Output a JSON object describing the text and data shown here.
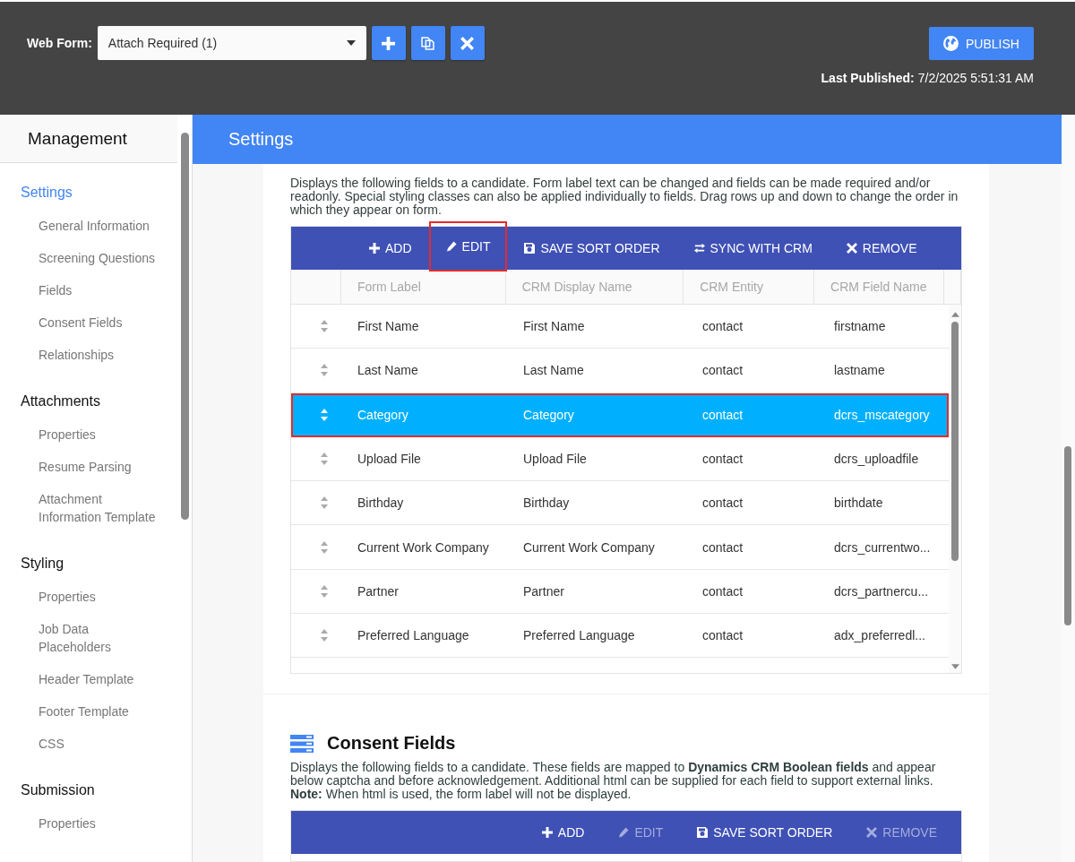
{
  "header": {
    "web_form_label": "Web Form:",
    "web_form_value": "Attach Required (1)",
    "buttons": [
      {
        "kind": "plus"
      },
      {
        "kind": "copy"
      },
      {
        "kind": "close"
      }
    ],
    "publish_button": "PUBLISH",
    "last_published_label": "Last Published:",
    "last_published_value": "7/2/2025 5:51:31 AM"
  },
  "sidebar": {
    "title": "Management",
    "sections": [
      {
        "title": "Settings",
        "selected": true,
        "items": [
          "General Information",
          "Screening Questions",
          "Fields",
          "Consent Fields",
          "Relationships"
        ]
      },
      {
        "title": "Attachments",
        "selected": false,
        "items": [
          "Properties",
          "Resume Parsing",
          "Attachment Information Template"
        ]
      },
      {
        "title": "Styling",
        "selected": false,
        "items": [
          "Properties",
          "Job Data Placeholders",
          "Header Template",
          "Footer Template",
          "CSS"
        ]
      },
      {
        "title": "Submission",
        "selected": false,
        "items": [
          "Properties"
        ]
      }
    ]
  },
  "page_title": "Settings",
  "fields_section": {
    "description": "Displays the following fields to a candidate. Form label text can be changed and fields can be made required and/or readonly. Special styling classes can also be applied individually to fields. Drag rows up and down to change the order in which they appear on form.",
    "actions": [
      {
        "label": "ADD",
        "kind": "add",
        "disabled": false,
        "highlighted": false
      },
      {
        "label": "EDIT",
        "kind": "edit",
        "disabled": false,
        "highlighted": true
      },
      {
        "label": "SAVE SORT ORDER",
        "kind": "save",
        "disabled": false,
        "highlighted": false
      },
      {
        "label": "SYNC WITH CRM",
        "kind": "sync",
        "disabled": false,
        "highlighted": false
      },
      {
        "label": "REMOVE",
        "kind": "remove",
        "disabled": false,
        "highlighted": false
      }
    ],
    "columns": [
      "Form Label",
      "CRM Display Name",
      "CRM Entity",
      "CRM Field Name"
    ],
    "rows": [
      {
        "cells": [
          "First Name",
          "First Name",
          "contact",
          "firstname"
        ],
        "selected": false,
        "highlighted": false
      },
      {
        "cells": [
          "Last Name",
          "Last Name",
          "contact",
          "lastname"
        ],
        "selected": false,
        "highlighted": false
      },
      {
        "cells": [
          "Category",
          "Category",
          "contact",
          "dcrs_mscategory"
        ],
        "selected": true,
        "highlighted": true
      },
      {
        "cells": [
          "Upload File",
          "Upload File",
          "contact",
          "dcrs_uploadfile"
        ],
        "selected": false,
        "highlighted": false
      },
      {
        "cells": [
          "Birthday",
          "Birthday",
          "contact",
          "birthdate"
        ],
        "selected": false,
        "highlighted": false
      },
      {
        "cells": [
          "Current Work Company",
          "Current Work Company",
          "contact",
          "dcrs_currentwo..."
        ],
        "selected": false,
        "highlighted": false
      },
      {
        "cells": [
          "Partner",
          "Partner",
          "contact",
          "dcrs_partnercu..."
        ],
        "selected": false,
        "highlighted": false
      },
      {
        "cells": [
          "Preferred Language",
          "Preferred Language",
          "contact",
          "adx_preferredl..."
        ],
        "selected": false,
        "highlighted": false
      }
    ]
  },
  "consent_section": {
    "title": "Consent Fields",
    "description": "Displays the following fields to a candidate. These fields are mapped to **Dynamics CRM Boolean fields** and appear below captcha and before acknowledgement. Additional html can be supplied for each field to support external links.",
    "note": "**Note:** When html is used, the form label will not be displayed.",
    "actions": [
      {
        "label": "ADD",
        "kind": "add",
        "disabled": false,
        "highlighted": false
      },
      {
        "label": "EDIT",
        "kind": "edit",
        "disabled": true,
        "highlighted": false
      },
      {
        "label": "SAVE SORT ORDER",
        "kind": "save",
        "disabled": false,
        "highlighted": false
      },
      {
        "label": "REMOVE",
        "kind": "remove",
        "disabled": true,
        "highlighted": false
      }
    ]
  }
}
